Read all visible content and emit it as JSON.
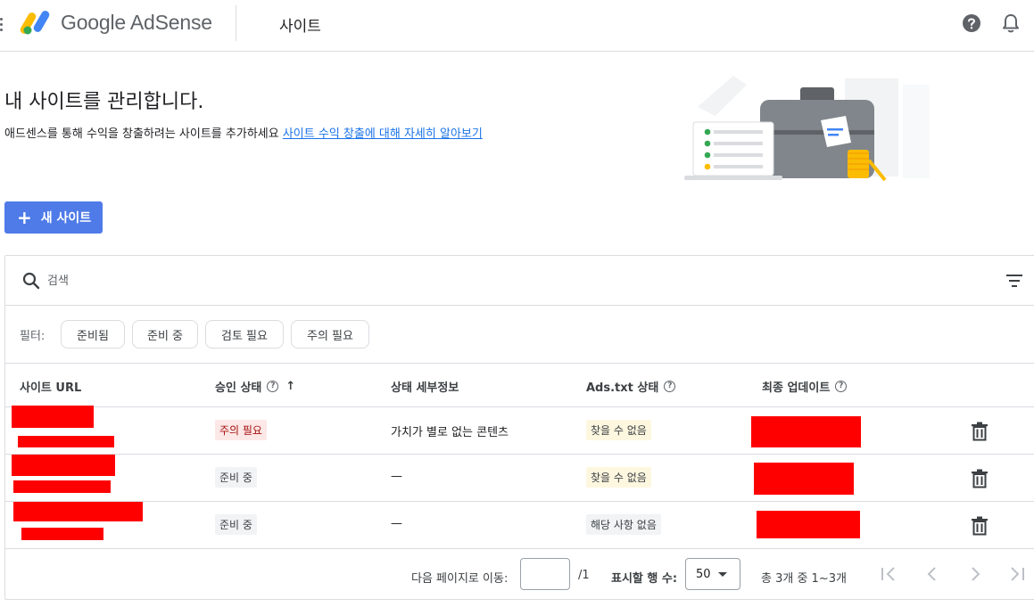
{
  "header": {
    "app_name": "Google AdSense",
    "section_title": "사이트"
  },
  "intro": {
    "title": "내 사이트를 관리합니다.",
    "description": "애드센스를 통해 수익을 창출하려는 사이트를 추가하세요",
    "link_text": "사이트 수익 창출에 대해 자세히 알아보기"
  },
  "new_site_button": {
    "plus": "+",
    "label": "새 사이트"
  },
  "search": {
    "placeholder": "검색"
  },
  "filters": {
    "label": "필터:",
    "chips": [
      "준비됨",
      "준비 중",
      "검토 필요",
      "주의 필요"
    ]
  },
  "table": {
    "columns": {
      "site_url": "사이트 URL",
      "approval_status": "승인 상태",
      "status_details": "상태 세부정보",
      "ads_txt": "Ads.txt 상태",
      "last_updated": "최종 업데이트"
    },
    "rows": [
      {
        "approval": "주의 필요",
        "details": "가치가 별로 없는 콘텐츠",
        "ads_txt": "찾을 수 없음"
      },
      {
        "approval": "준비 중",
        "details": "—",
        "ads_txt": "찾을 수 없음"
      },
      {
        "approval": "준비 중",
        "details": "—",
        "ads_txt": "해당 사항 없음"
      }
    ]
  },
  "pagination": {
    "goto_label": "다음 페이지로 이동:",
    "goto_value": "",
    "total_pages": "/1",
    "rows_label": "표시할 행 수:",
    "rows_value": "50",
    "range": "총 3개 중 1~3개"
  },
  "colors": {
    "primary_button": "#4f7be8",
    "link": "#1a73e8",
    "redaction": "#ff0000"
  }
}
